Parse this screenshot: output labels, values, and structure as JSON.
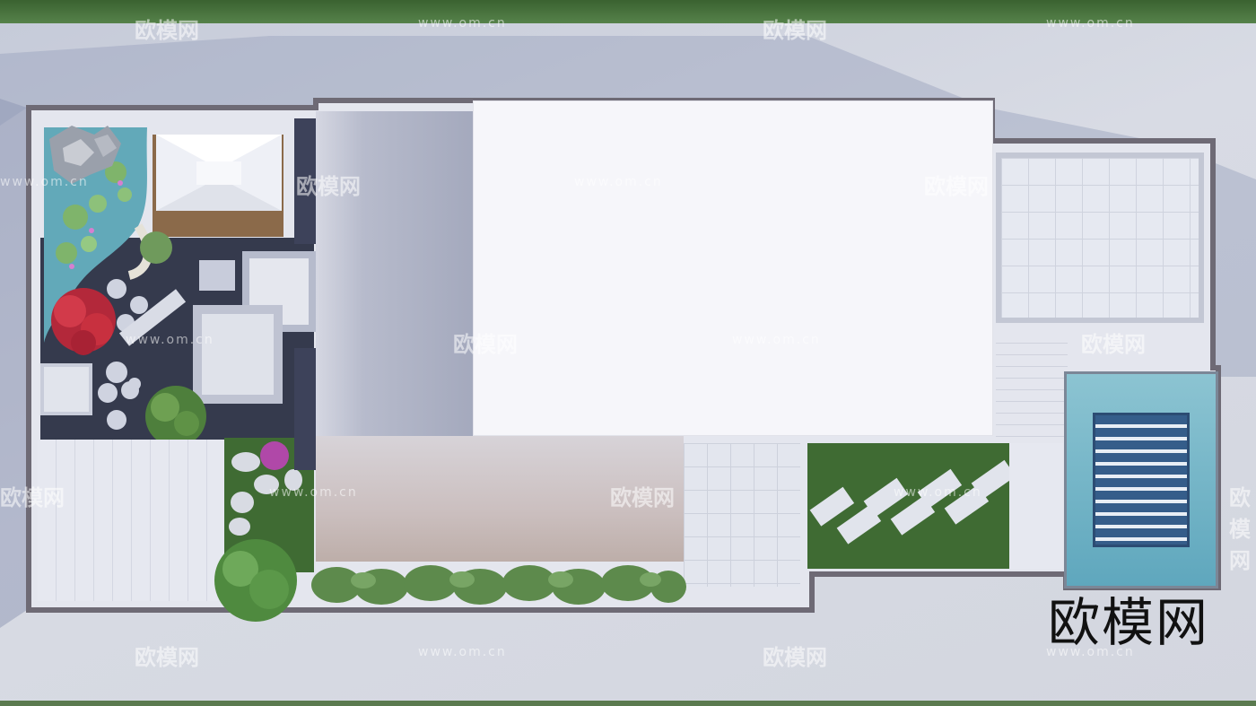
{
  "watermark": {
    "site": "www.om.cn",
    "brand": "欧模网"
  },
  "logo": {
    "text": "欧模网"
  },
  "colors": {
    "ground": "#cfd3de",
    "grass": "#3f6b33",
    "wall": "#6e6a75",
    "roof_main": "#f4f4f8",
    "pool_water": "#5fa7bd"
  }
}
